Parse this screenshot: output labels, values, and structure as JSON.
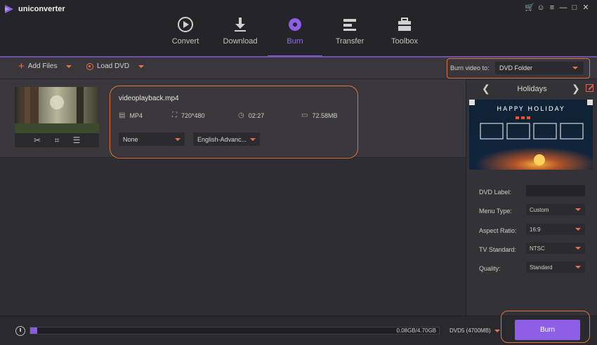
{
  "app": {
    "title": "uniconverter"
  },
  "nav": [
    {
      "label": "Convert",
      "icon": "convert-icon"
    },
    {
      "label": "Download",
      "icon": "download-icon"
    },
    {
      "label": "Burn",
      "icon": "burn-icon",
      "active": true
    },
    {
      "label": "Transfer",
      "icon": "transfer-icon"
    },
    {
      "label": "Toolbox",
      "icon": "toolbox-icon"
    }
  ],
  "toolbar": {
    "add_files": "Add Files",
    "load_dvd": "Load DVD",
    "burn_to_label": "Burn video to:",
    "burn_to_value": "DVD Folder"
  },
  "file": {
    "name": "videoplayback.mp4",
    "format": "MP4",
    "resolution": "720*480",
    "duration": "02:27",
    "size": "72.58MB",
    "subtitle": "None",
    "audio": "English-Advanc..."
  },
  "template": {
    "name": "Holidays",
    "preview_title": "HAPPY HOLIDAY"
  },
  "settings": {
    "dvd_label": {
      "label": "DVD Label:",
      "value": ""
    },
    "menu_type": {
      "label": "Menu Type:",
      "value": "Custom"
    },
    "aspect_ratio": {
      "label": "Aspect Ratio:",
      "value": "16:9"
    },
    "tv_standard": {
      "label": "TV Standard:",
      "value": "NTSC"
    },
    "quality": {
      "label": "Quality:",
      "value": "Standard"
    }
  },
  "bottom": {
    "usage": "0.08GB/4.70GB",
    "usage_fraction": 0.017,
    "disc_type": "DVD5 (4700MB)",
    "burn_label": "Burn"
  },
  "colors": {
    "accent": "#8d5fe6",
    "highlight": "#e0733c"
  }
}
